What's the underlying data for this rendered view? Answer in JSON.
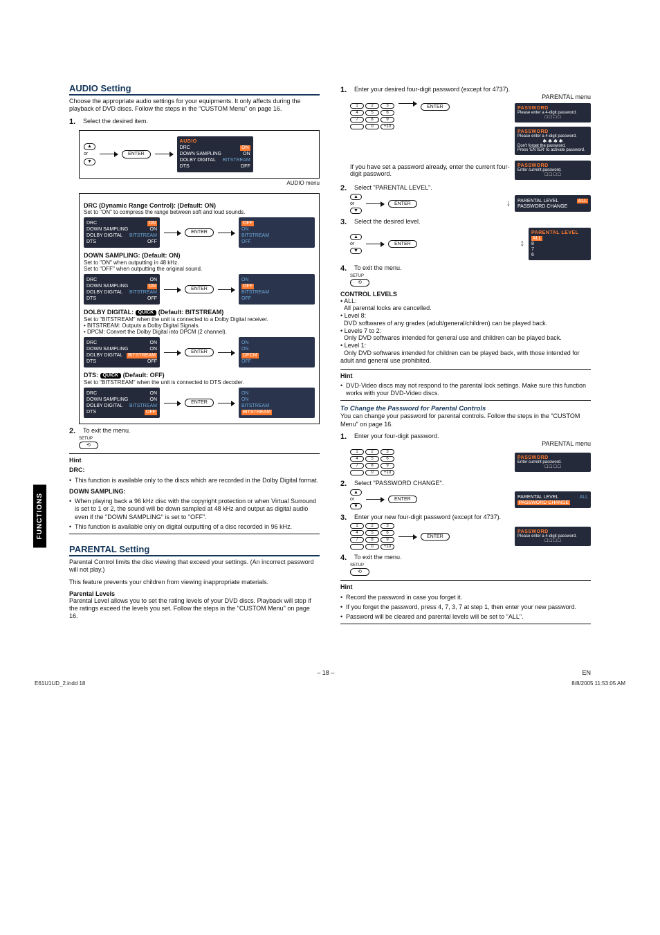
{
  "sideTab": "FUNCTIONS",
  "left": {
    "audioHeading": "AUDIO Setting",
    "audioIntro": "Choose the appropriate audio settings for your equipments. It only affects during the playback of DVD discs. Follow the steps in the \"CUSTOM Menu\" on page 16.",
    "step1": "Select the desired item.",
    "audioMenuCaption": "AUDIO menu",
    "enterLabel": "ENTER",
    "upDownOr": "or",
    "osdAudio": {
      "header": "AUDIO",
      "rows": [
        {
          "k": "DRC",
          "v": "ON"
        },
        {
          "k": "DOWN SAMPLING",
          "v": "ON"
        },
        {
          "k": "DOLBY DIGITAL",
          "v": "BITSTREAM"
        },
        {
          "k": "DTS",
          "v": "OFF"
        }
      ]
    },
    "drc": {
      "title": "DRC (Dynamic Range Control): (Default: ON)",
      "body": "Set to \"ON\" to compress the range between soft and loud sounds.",
      "left": [
        {
          "k": "DRC",
          "v": "ON"
        },
        {
          "k": "DOWN SAMPLING",
          "v": "ON"
        },
        {
          "k": "DOLBY DIGITAL",
          "v": "BITSTREAM"
        },
        {
          "k": "DTS",
          "v": "OFF"
        }
      ],
      "right": [
        "OFF",
        "ON",
        "BITSTREAM",
        "OFF"
      ]
    },
    "down": {
      "title": "DOWN SAMPLING: (Default: ON)",
      "body1": "Set to \"ON\" when outputting in 48 kHz.",
      "body2": "Set to \"OFF\" when outputting the original sound.",
      "left": [
        {
          "k": "DRC",
          "v": "ON"
        },
        {
          "k": "DOWN SAMPLING",
          "v": "ON"
        },
        {
          "k": "DOLBY DIGITAL",
          "v": "BITSTREAM"
        },
        {
          "k": "DTS",
          "v": "OFF"
        }
      ],
      "right": [
        "ON",
        "OFF",
        "BITSTREAM",
        "OFF"
      ]
    },
    "dolby": {
      "titlePre": "DOLBY DIGITAL: ",
      "quick": "QUICK",
      "titlePost": "(Default: BITSTREAM)",
      "body1": "Set to \"BITSTREAM\" when the unit is connected to a Dolby Digital receiver.",
      "b1": "• BITSTREAM: Outputs a Dolby Digital Signals.",
      "b2": "• DPCM: Convert the Dolby Digital into DPCM (2 channel).",
      "left": [
        {
          "k": "DRC",
          "v": "ON"
        },
        {
          "k": "DOWN SAMPLING",
          "v": "ON"
        },
        {
          "k": "DOLBY DIGITAL",
          "v": "BITSTREAM"
        },
        {
          "k": "DTS",
          "v": "OFF"
        }
      ],
      "right": [
        "ON",
        "ON",
        "DPCM",
        "OFF"
      ]
    },
    "dts": {
      "titlePre": "DTS: ",
      "quick": "QUICK",
      "titlePost": "(Default: OFF)",
      "body": "Set to \"BITSTREAM\" when the unit is connected to DTS decoder.",
      "left": [
        {
          "k": "DRC",
          "v": "ON"
        },
        {
          "k": "DOWN SAMPLING",
          "v": "ON"
        },
        {
          "k": "DOLBY DIGITAL",
          "v": "BITSTREAM"
        },
        {
          "k": "DTS",
          "v": "OFF"
        }
      ],
      "right": [
        "ON",
        "ON",
        "BITSTREAM",
        "BITSTREAM"
      ]
    },
    "step2": "To exit the menu.",
    "setupLabel": "SETUP",
    "hint": {
      "title": "Hint",
      "drcLabel": "DRC:",
      "drcBody": "This function is available only to the discs which are recorded in the Dolby Digital format.",
      "dsLabel": "DOWN SAMPLING:",
      "ds1": "When playing back a 96 kHz disc with the copyright protection or when Virtual Surround is set to 1 or 2, the sound will be down sampled at 48 kHz and output as digital audio even if the \"DOWN SAMPLING\" is set to \"OFF\".",
      "ds2": "This function is available only on digital outputting of a disc recorded in 96 kHz."
    },
    "parentalHeading": "PARENTAL Setting",
    "parentalIntro1": "Parental Control limits the disc viewing that exceed your settings. (An incorrect password will not play.)",
    "parentalIntro2": "This feature prevents your children from viewing inappropriate materials.",
    "parentalLevelsHead": "Parental Levels",
    "parentalLevelsBody": "Parental Level allows you to set the rating levels of your DVD discs. Playback will stop if the ratings exceed the levels you set. Follow the steps in the \"CUSTOM Menu\" on page 16."
  },
  "right": {
    "step1": "Enter your desired four-digit password (except for 4737).",
    "parentalMenuCaption": "PARENTAL menu",
    "setPwNote": "If you have set a password already, enter the current four-digit password.",
    "osdPw1": {
      "h": "PASSWORD",
      "l1": "Please enter a 4-digit password.",
      "boxes": "□ □ □ □"
    },
    "osdPw2": {
      "h": "PASSWORD",
      "l1": "Please enter a 4-digit password.",
      "stars": "✱ ✱ ✱ ✱",
      "l2": "Don't forget the password.",
      "l3": "Press 'ENTER' to activate password."
    },
    "osdPw3": {
      "h": "PASSWORD",
      "l1": "Enter current password.",
      "boxes": "□ □ □ □"
    },
    "step2": "Select \"PARENTAL LEVEL\".",
    "osdLevelMenu": {
      "r1": "PARENTAL LEVEL",
      "r1v": "ALL",
      "r2": "PASSWORD CHANGE"
    },
    "step3": "Select the desired level.",
    "osdLevelSel": {
      "h": "PARENTAL LEVEL",
      "opts": [
        "ALL",
        "8",
        "7",
        "6"
      ]
    },
    "step4": "To exit the menu.",
    "controlLevelsHead": "CONTROL LEVELS",
    "levels": [
      {
        "k": "• ALL:",
        "v": "All parental locks are cancelled."
      },
      {
        "k": "• Level 8:",
        "v": "DVD softwares of any grades (adult/general/children) can be played back."
      },
      {
        "k": "• Levels 7 to 2:",
        "v": "Only DVD softwares intended for general use and children can be played back."
      },
      {
        "k": "• Level 1:",
        "v": "Only DVD softwares intended for children can be played back, with those intended for adult and general use prohibited."
      }
    ],
    "hint1": {
      "title": "Hint",
      "body": "DVD-Video discs may not respond to the parental lock settings. Make sure this function works with your DVD-Video discs."
    },
    "changeHead": "To Change the Password for Parental Controls",
    "changeIntro": "You can change your password for parental controls. Follow the steps in the \"CUSTOM Menu\" on page 16.",
    "c1": "Enter your four-digit password.",
    "c2": "Select \"PASSWORD CHANGE\".",
    "c3": "Enter your new four-digit password (except for 4737).",
    "c4": "To exit the menu.",
    "osdPwChange": {
      "r1": "PARENTAL LEVEL",
      "r1v": "ALL",
      "r2": "PASSWORD CHANGE"
    },
    "osdNewPw": {
      "h": "PASSWORD",
      "l1": "Please enter a 4-digit password.",
      "boxes": "□ □ □ □"
    },
    "hint2": {
      "title": "Hint",
      "b1": "Record the password in case you forget it.",
      "b2": "If you forget the password, press 4, 7, 3, 7 at step 1, then enter your new password.",
      "b3": "Password will be cleared and parental levels will be set to \"ALL\"."
    }
  },
  "footer": {
    "page": "– 18 –",
    "lang": "EN"
  },
  "print": {
    "file": "E61U1UD_2.indd   18",
    "ts": "8/8/2005   11:53:05 AM"
  },
  "keypad": [
    "1",
    "2",
    "3",
    "4",
    "5",
    "6",
    "7",
    "8",
    "9",
    "0",
    "+10"
  ]
}
